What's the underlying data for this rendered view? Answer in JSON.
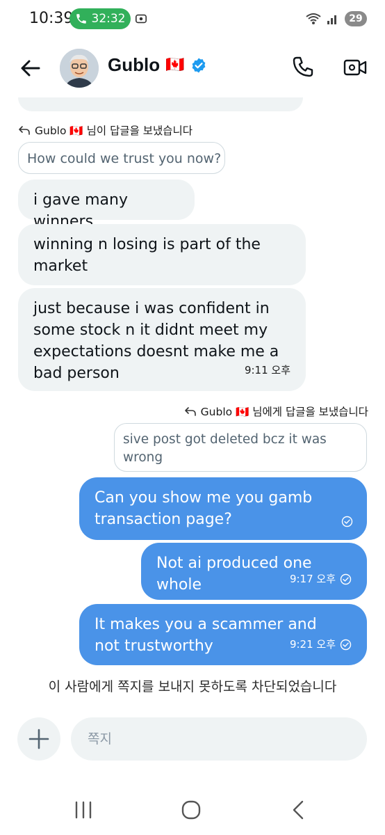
{
  "status_bar": {
    "time": "10:39",
    "call_duration": "32:32",
    "battery": "29"
  },
  "header": {
    "contact_name": "Gublo",
    "flag": "🇨🇦"
  },
  "messages": [
    {
      "reply_label": "Gublo 🇨🇦 님이 답글을 보냈습니다",
      "quote": "How could we trust you  now?"
    },
    {
      "text": "i gave many winners"
    },
    {
      "text": "winning n losing is part of the market"
    },
    {
      "text": "just because i was confident in some stock n it didnt meet my expectations doesnt make me a bad person",
      "time": "9:11 오후"
    },
    {
      "reply_label": "Gublo 🇨🇦 님에게 답글을 보냈습니다",
      "quote": "sive post got deleted bcz it was wrong"
    },
    {
      "text": "Can you show me you gamb transaction page?"
    },
    {
      "text": "Not ai produced one whole",
      "time": "9:17 오후"
    },
    {
      "text": "It makes you a scammer and not trustworthy",
      "time": "9:21 오후"
    }
  ],
  "blocked_notice": "이 사람에게 쪽지를 보내지 못하도록 차단되었습니다",
  "composer": {
    "placeholder": "쪽지"
  },
  "colors": {
    "sent_bubble": "#4a93e8",
    "received_bubble": "#eff3f4",
    "call_pill": "#31b05a",
    "verified": "#1d9bf0"
  }
}
